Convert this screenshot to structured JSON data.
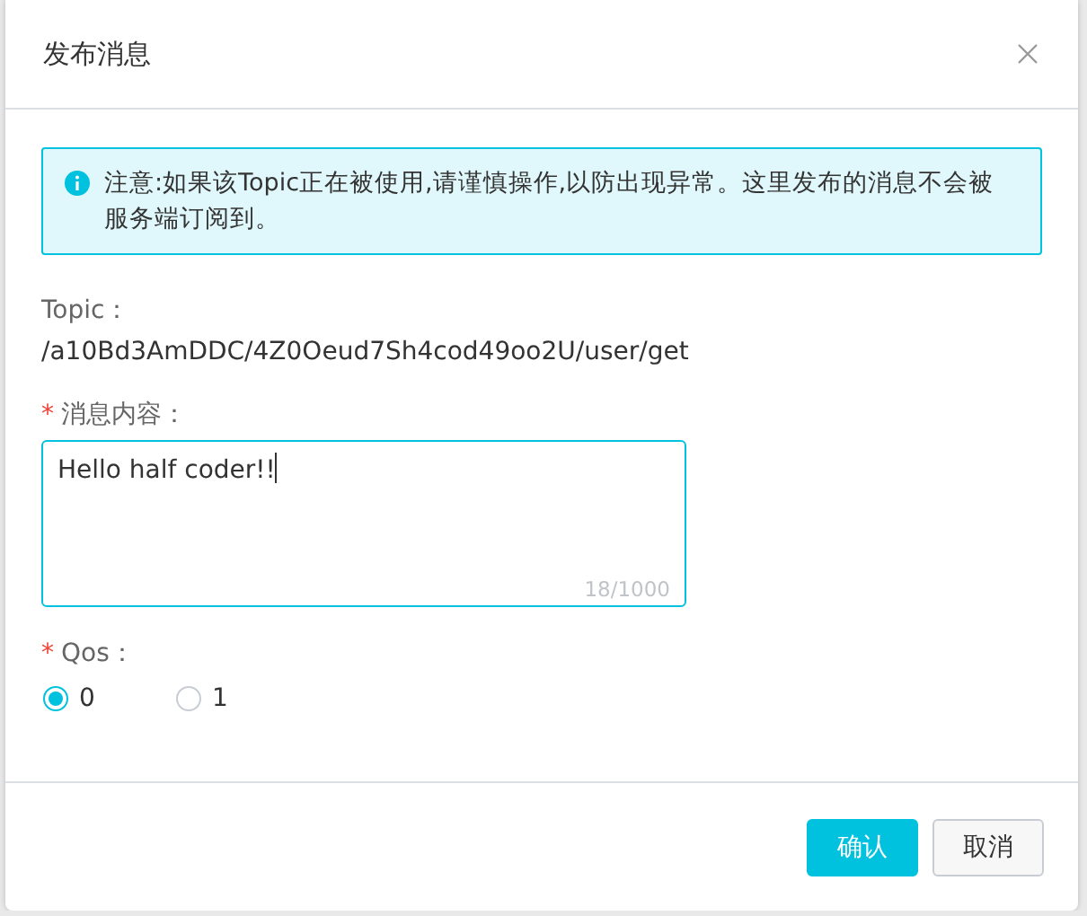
{
  "dialog": {
    "title": "发布消息"
  },
  "alert": {
    "text": "注意:如果该Topic正在被使用,请谨慎操作,以防出现异常。这里发布的消息不会被服务端订阅到。"
  },
  "topic": {
    "label": "Topic：",
    "value": "/a10Bd3AmDDC/4Z0Oeud7Sh4cod49oo2U/user/get"
  },
  "message": {
    "required_mark": "*",
    "label": "消息内容：",
    "value": "Hello half coder!!",
    "counter": "18/1000",
    "focused": true
  },
  "qos": {
    "required_mark": "*",
    "label": "Qos：",
    "options": [
      {
        "label": "0",
        "selected": true
      },
      {
        "label": "1",
        "selected": false
      }
    ]
  },
  "buttons": [
    {
      "label": "确认",
      "kind": "primary"
    },
    {
      "label": "取消",
      "kind": "default"
    }
  ]
}
